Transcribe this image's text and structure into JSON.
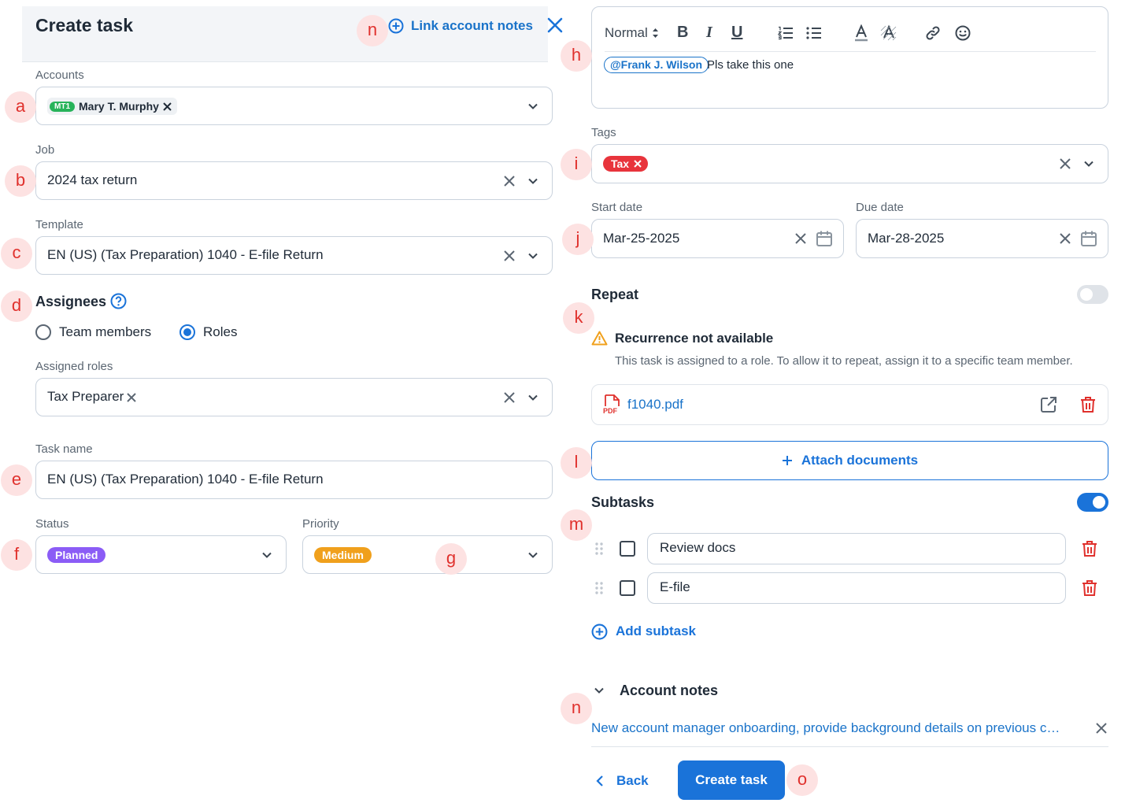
{
  "header": {
    "title": "Create task",
    "link_notes": "Link account notes"
  },
  "left": {
    "accounts": {
      "label": "Accounts",
      "chip_badge": "MT1",
      "chip_name": "Mary T. Murphy"
    },
    "job": {
      "label": "Job",
      "value": "2024 tax return"
    },
    "template": {
      "label": "Template",
      "value": "EN (US) (Tax Preparation) 1040 - E-file Return"
    },
    "assignees": {
      "title": "Assignees",
      "opt_team": "Team members",
      "opt_roles": "Roles",
      "selected": "Roles"
    },
    "assigned_roles": {
      "label": "Assigned roles",
      "value": "Tax Preparer"
    },
    "task_name": {
      "label": "Task name",
      "value": "EN (US) (Tax Preparation) 1040 - E-file Return"
    },
    "status": {
      "label": "Status",
      "value": "Planned",
      "color": "#8b5cf6"
    },
    "priority": {
      "label": "Priority",
      "value": "Medium",
      "color": "#f0a01c"
    }
  },
  "right": {
    "editor": {
      "style": "Normal",
      "mention": "@Frank J. Wilson",
      "text": "Pls take this one"
    },
    "tags": {
      "label": "Tags",
      "tag": "Tax",
      "color": "#e8343c"
    },
    "start_date": {
      "label": "Start date",
      "value": "Mar-25-2025"
    },
    "due_date": {
      "label": "Due date",
      "value": "Mar-28-2025"
    },
    "repeat": {
      "title": "Repeat",
      "warn_title": "Recurrence not available",
      "warn_text": "This task is assigned to a role. To allow it to repeat, assign it to a specific team member."
    },
    "file": {
      "name": "f1040.pdf",
      "ext": "PDF"
    },
    "attach": "Attach documents",
    "subtasks": {
      "title": "Subtasks",
      "items": [
        "Review docs",
        "E-file"
      ],
      "add": "Add subtask"
    },
    "notes": {
      "title": "Account notes",
      "text": "New account manager onboarding, provide background details on previous c…"
    },
    "back": "Back",
    "create": "Create task"
  },
  "markers": {
    "a": "a",
    "b": "b",
    "c": "c",
    "d": "d",
    "e": "e",
    "f": "f",
    "g": "g",
    "h": "h",
    "i": "i",
    "j": "j",
    "k": "k",
    "l": "l",
    "m": "m",
    "n": "n",
    "o": "o"
  },
  "colors": {
    "accent": "#1a73d9",
    "danger": "#e0312d",
    "marker_bg": "#fde2e2"
  }
}
